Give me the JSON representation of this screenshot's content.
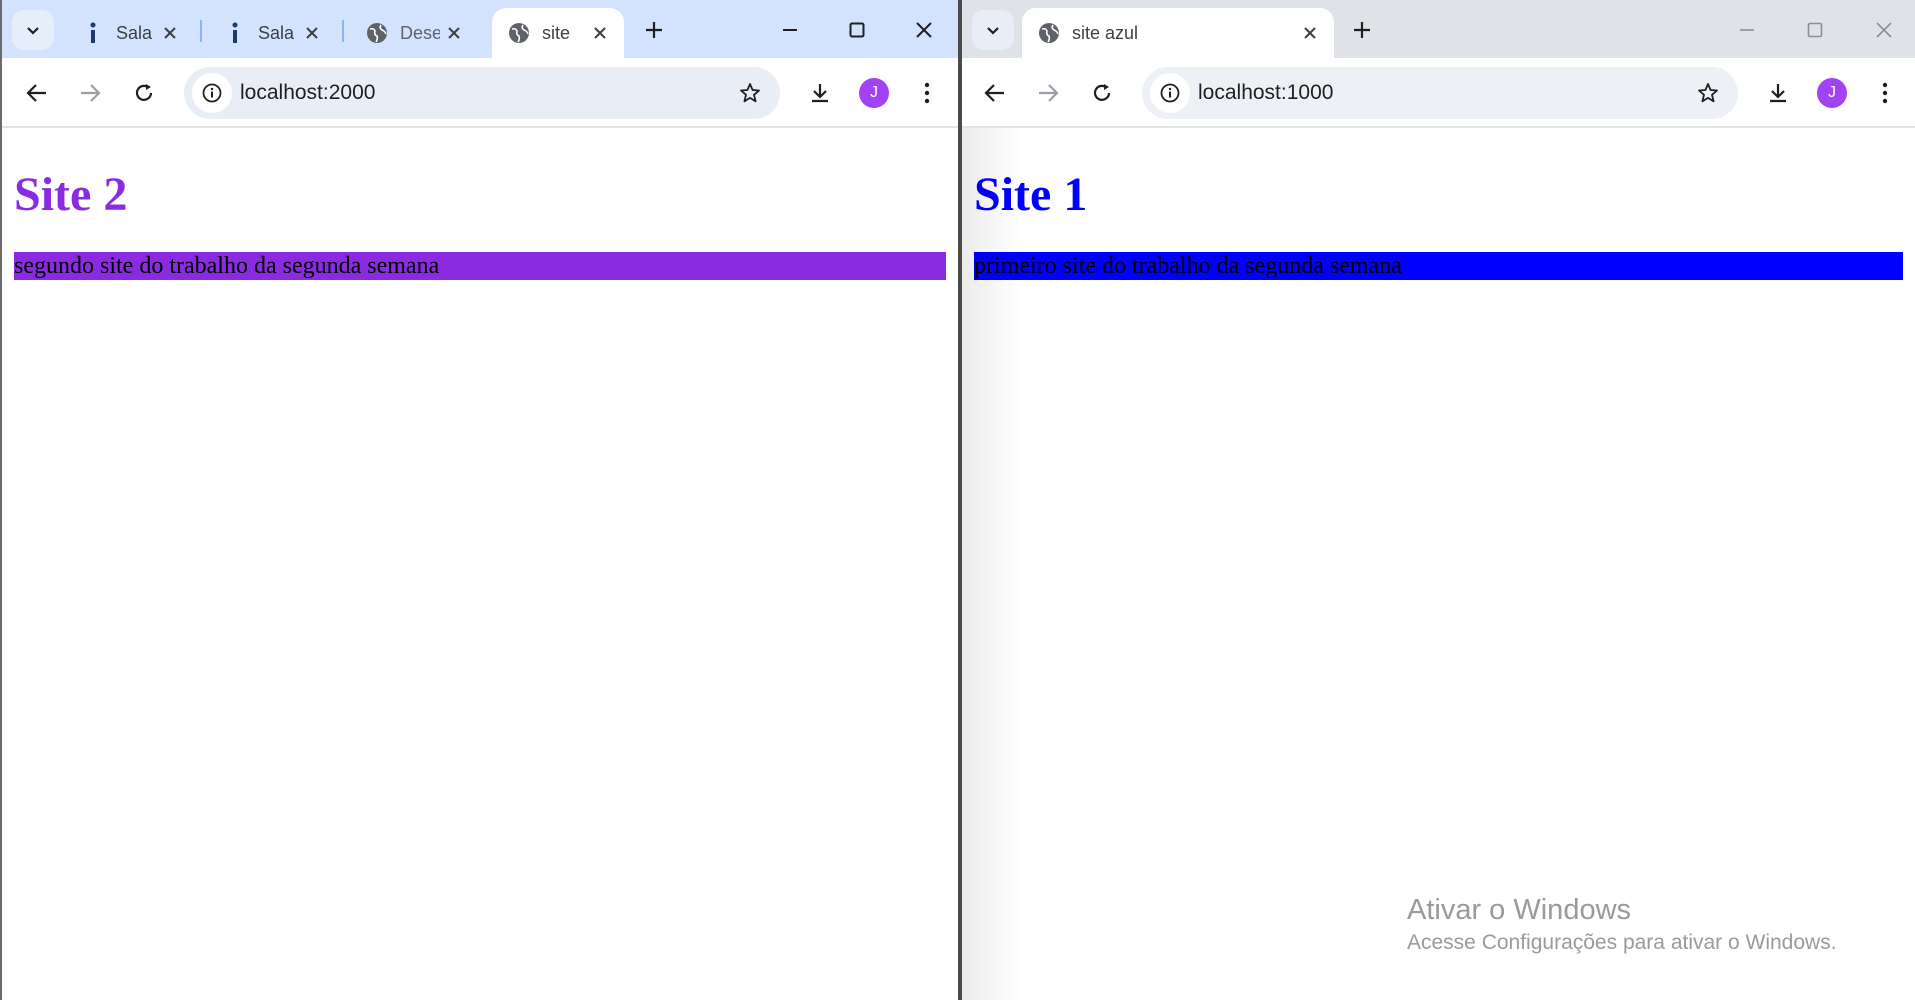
{
  "left_window": {
    "tabs": [
      {
        "title": "Sala",
        "icon": "info-favicon",
        "active": false
      },
      {
        "title": "Sala",
        "icon": "info-favicon",
        "active": false
      },
      {
        "title": "Dese",
        "icon": "globe-icon",
        "active": false
      },
      {
        "title": "site",
        "icon": "globe-icon",
        "active": true
      }
    ],
    "url": "localhost:2000",
    "avatar_initial": "J",
    "page": {
      "heading": "Site 2",
      "heading_color": "#8a2be2",
      "paragraph": "segundo site do trabalho da segunda semana",
      "paragraph_bg": "#8a2be2"
    }
  },
  "right_window": {
    "tabs": [
      {
        "title": "site azul",
        "icon": "globe-icon",
        "active": true
      }
    ],
    "url": "localhost:1000",
    "avatar_initial": "J",
    "page": {
      "heading": "Site 1",
      "heading_color": "#0000ff",
      "paragraph": "primeiro site do trabalho da segunda semana",
      "paragraph_bg": "#0000ff"
    }
  },
  "watermark": {
    "title": "Ativar o Windows",
    "subtitle": "Acesse Configurações para ativar o Windows."
  }
}
